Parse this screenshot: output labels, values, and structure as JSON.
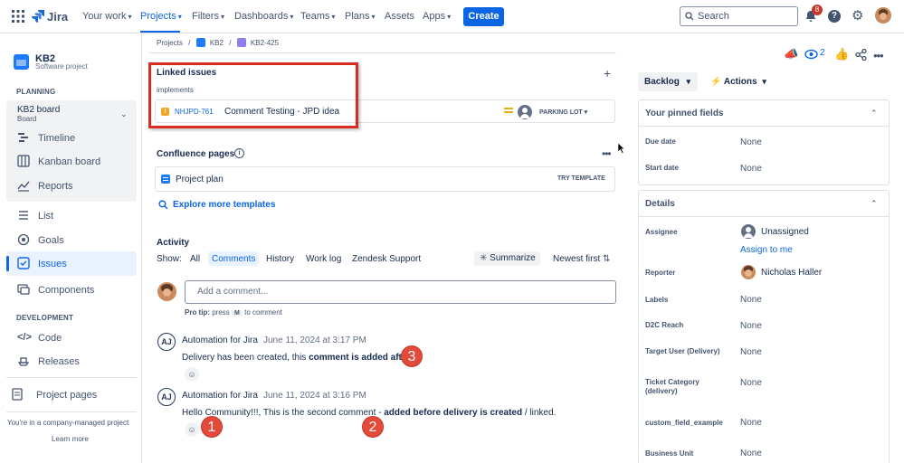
{
  "topbar": {
    "product": "Jira",
    "nav": [
      {
        "label": "Your work"
      },
      {
        "label": "Projects"
      },
      {
        "label": "Filters"
      },
      {
        "label": "Dashboards"
      },
      {
        "label": "Teams"
      },
      {
        "label": "Plans"
      },
      {
        "label": "Assets"
      },
      {
        "label": "Apps"
      }
    ],
    "create_label": "Create",
    "search_placeholder": "Search",
    "notification_count": "8"
  },
  "sidebar": {
    "project_name": "KB2",
    "project_type": "Software project",
    "planning_heading": "PLANNING",
    "board_name": "KB2 board",
    "board_sub": "Board",
    "items_planning": [
      {
        "label": "Timeline"
      },
      {
        "label": "Kanban board"
      },
      {
        "label": "Reports"
      }
    ],
    "items_main": [
      {
        "label": "List"
      },
      {
        "label": "Goals"
      },
      {
        "label": "Issues"
      },
      {
        "label": "Components"
      }
    ],
    "development_heading": "DEVELOPMENT",
    "items_dev": [
      {
        "label": "Code"
      },
      {
        "label": "Releases"
      }
    ],
    "project_pages": "Project pages",
    "footer_note": "You're in a company-managed project",
    "learn_more": "Learn more"
  },
  "breadcrumb": {
    "projects": "Projects",
    "project": "KB2",
    "issue": "KB2-425"
  },
  "linked_issues": {
    "title": "Linked issues",
    "relation": "implements",
    "issue_key": "NHJPD-761",
    "issue_summary": "Comment Testing - JPD idea",
    "status": "PARKING LOT"
  },
  "confluence": {
    "title": "Confluence pages",
    "page": "Project plan",
    "try_template": "TRY TEMPLATE",
    "explore": "Explore more templates"
  },
  "activity": {
    "title": "Activity",
    "show_label": "Show:",
    "tabs": [
      "All",
      "Comments",
      "History",
      "Work log",
      "Zendesk Support"
    ],
    "summarize": "Summarize",
    "sort": "Newest first",
    "comment_placeholder": "Add a comment...",
    "pro_tip_prefix": "Pro tip:",
    "pro_tip_press": "press",
    "pro_tip_key": "M",
    "pro_tip_suffix": "to comment",
    "comments": [
      {
        "author": "Automation for Jira",
        "date": "June 11, 2024 at 3:17 PM",
        "text_pre": "Delivery has been created, this ",
        "text_bold": "comment is added after",
        "text_post": ".",
        "marker": "3"
      },
      {
        "author": "Automation for Jira",
        "date": "June 11, 2024 at 3:16 PM",
        "text_pre": "Hello Community!!!, This is the second comment - ",
        "text_bold": "added before delivery is created",
        "text_post": " / linked.",
        "marker_1": "1",
        "marker_2": "2"
      }
    ],
    "avatar_initials": "AJ"
  },
  "right_panel": {
    "watch_count": "2",
    "status_button": "Backlog",
    "actions": "Actions",
    "pinned_title": "Your pinned fields",
    "pinned": [
      {
        "label": "Due date",
        "value": "None"
      },
      {
        "label": "Start date",
        "value": "None"
      }
    ],
    "details_title": "Details",
    "assignee_label": "Assignee",
    "assignee_value": "Unassigned",
    "assign_to_me": "Assign to me",
    "reporter_label": "Reporter",
    "reporter_value": "Nicholas Haller",
    "fields": [
      {
        "label": "Labels",
        "value": "None"
      },
      {
        "label": "D2C Reach",
        "value": "None"
      },
      {
        "label": "Target User (Delivery)",
        "value": "None"
      },
      {
        "label": "Ticket Category (delivery)",
        "value": "None"
      },
      {
        "label": "custom_field_example",
        "value": "None"
      },
      {
        "label": "Business Unit",
        "value": "None"
      }
    ]
  },
  "colors": {
    "accent": "#0c66e4",
    "highlight_box": "#d92d20",
    "marker": "#e5493a"
  }
}
